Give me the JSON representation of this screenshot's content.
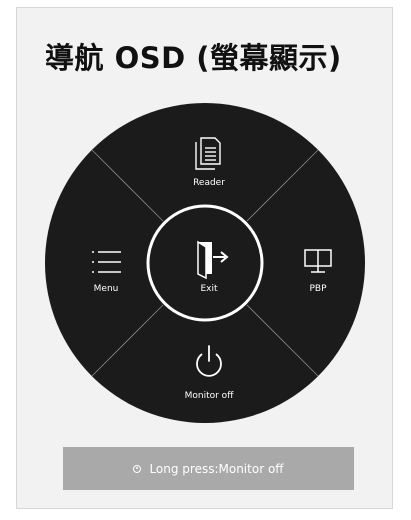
{
  "title": "導航 OSD (螢幕顯示)",
  "joystick_menu": {
    "top": {
      "label": "Reader",
      "icon": "document-icon"
    },
    "left": {
      "label": "Menu",
      "icon": "list-icon"
    },
    "center": {
      "label": "Exit",
      "icon": "exit-door-icon"
    },
    "right": {
      "label": "PBP",
      "icon": "dual-monitor-icon"
    },
    "bottom": {
      "label": "Monitor off",
      "icon": "power-icon"
    }
  },
  "hint": {
    "text": "Long press:Monitor off",
    "icon": "joystick-press-icon"
  },
  "colors": {
    "wheel": "#1b1b1b",
    "ring": "#ffffff",
    "card_background": "#f2f2f2",
    "hint_background": "#a9a9a9"
  }
}
